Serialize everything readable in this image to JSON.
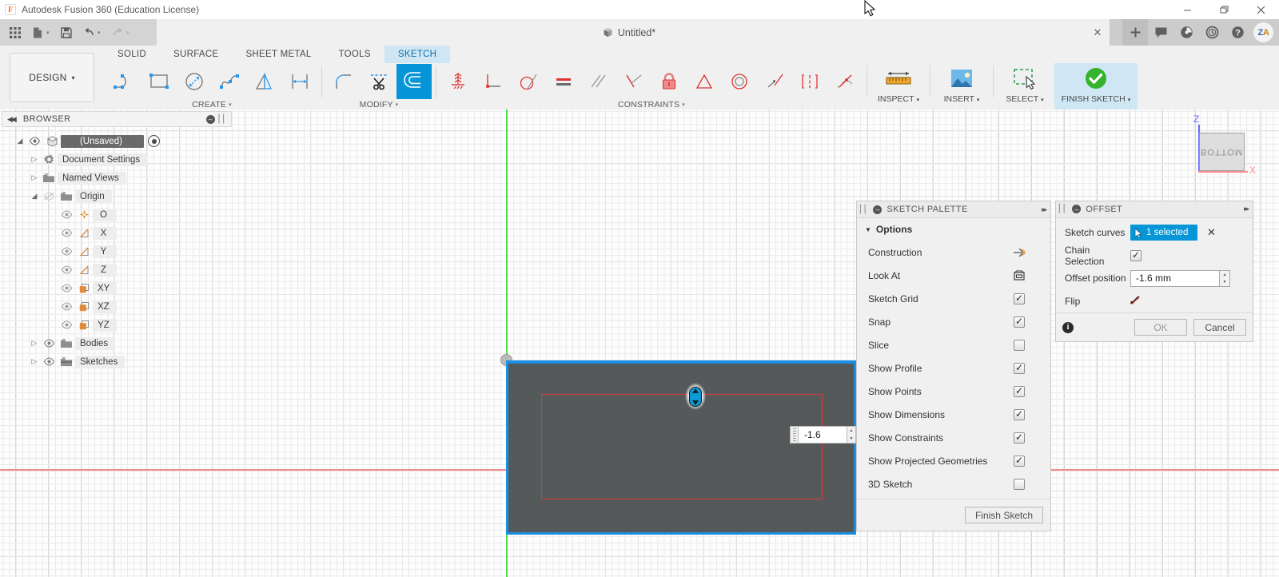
{
  "titlebar": {
    "app_title": "Autodesk Fusion 360 (Education License)",
    "logo_letter": "F",
    "minimize": "—",
    "maximize": "❐",
    "close": "✕"
  },
  "quick_access": {
    "grid_icon": "app-grid-icon",
    "new_icon": "new-document-icon",
    "save_icon": "save-icon",
    "undo_icon": "undo-icon",
    "redo_icon": "redo-icon",
    "document_title": "Untitled*",
    "tab_close": "✕",
    "add_tab": "+",
    "comments_icon": "comments-icon",
    "data_panel_icon": "data-panel-icon",
    "recent_icon": "recent-icon",
    "help_icon": "help-icon",
    "avatar_initials_z": "Z",
    "avatar_initials_a": "A"
  },
  "ribbon": {
    "workspace": "DESIGN",
    "workspace_caret": "▾",
    "tabs": [
      {
        "label": "SOLID",
        "active": false
      },
      {
        "label": "SURFACE",
        "active": false
      },
      {
        "label": "SHEET METAL",
        "active": false
      },
      {
        "label": "TOOLS",
        "active": false
      },
      {
        "label": "SKETCH",
        "active": true
      }
    ],
    "panels": [
      {
        "title": "CREATE",
        "has_dropdown": true
      },
      {
        "title": "MODIFY",
        "has_dropdown": true
      },
      {
        "title": "CONSTRAINTS",
        "has_dropdown": true
      },
      {
        "title": "INSPECT",
        "has_dropdown": true
      },
      {
        "title": "INSERT",
        "has_dropdown": true
      },
      {
        "title": "SELECT",
        "has_dropdown": true
      },
      {
        "title": "FINISH SKETCH",
        "has_dropdown": true
      }
    ],
    "create_tools": [
      "line-icon",
      "rectangle-icon",
      "circle-icon",
      "spline-icon",
      "mirror-icon",
      "dimension-icon"
    ],
    "modify_tools": [
      "fillet-icon",
      "trim-icon",
      "offset-icon"
    ],
    "constraint_tools": [
      "coincident-icon",
      "horizontal-vertical-icon",
      "tangent-icon",
      "equal-icon",
      "parallel-icon",
      "perpendicular-icon",
      "fix-lock-icon",
      "midpoint-icon",
      "concentric-icon",
      "collinear-icon",
      "symmetry-icon",
      "curvature-icon"
    ],
    "inspect_icon": "measure-ruler-icon",
    "insert_icon": "insert-image-icon",
    "select_icon": "select-window-icon",
    "finish_sketch_icon": "green-check-icon",
    "dropdown_caret": "▾"
  },
  "browser": {
    "header_title": "BROWSER",
    "collapse_arrows": "◀◀",
    "minimize": "—",
    "grip": "⁞⁞",
    "items": [
      {
        "label": "(Unsaved)",
        "indent": 0,
        "twist": "◢",
        "icon": "component-cube-icon",
        "eye": true,
        "root": true,
        "radio": true
      },
      {
        "label": "Document Settings",
        "indent": 1,
        "twist": "▷",
        "icon": "gear-icon",
        "eye": false,
        "root": false,
        "radio": false
      },
      {
        "label": "Named Views",
        "indent": 1,
        "twist": "▷",
        "icon": "folder-icon",
        "eye": false,
        "root": false,
        "radio": false
      },
      {
        "label": "Origin",
        "indent": 1,
        "twist": "◢",
        "icon": "folder-icon",
        "eye": true,
        "eye_off": true,
        "root": false,
        "radio": false
      },
      {
        "label": "O",
        "indent": 2,
        "twist": "",
        "icon": "origin-point-icon",
        "eye": true,
        "root": false,
        "radio": false
      },
      {
        "label": "X",
        "indent": 2,
        "twist": "",
        "icon": "axis-icon",
        "eye": true,
        "root": false,
        "radio": false
      },
      {
        "label": "Y",
        "indent": 2,
        "twist": "",
        "icon": "axis-icon",
        "eye": true,
        "root": false,
        "radio": false
      },
      {
        "label": "Z",
        "indent": 2,
        "twist": "",
        "icon": "axis-icon",
        "eye": true,
        "root": false,
        "radio": false
      },
      {
        "label": "XY",
        "indent": 2,
        "twist": "",
        "icon": "plane-icon",
        "eye": true,
        "root": false,
        "radio": false
      },
      {
        "label": "XZ",
        "indent": 2,
        "twist": "",
        "icon": "plane-icon",
        "eye": true,
        "root": false,
        "radio": false
      },
      {
        "label": "YZ",
        "indent": 2,
        "twist": "",
        "icon": "plane-icon",
        "eye": true,
        "root": false,
        "radio": false
      },
      {
        "label": "Bodies",
        "indent": 1,
        "twist": "▷",
        "icon": "folder-icon",
        "eye": true,
        "root": false,
        "radio": false
      },
      {
        "label": "Sketches",
        "indent": 1,
        "twist": "▷",
        "icon": "sketches-folder-icon",
        "eye": true,
        "root": false,
        "radio": false
      }
    ]
  },
  "sketch_palette": {
    "title": "SKETCH PALETTE",
    "minimize": "—",
    "expand": "▸▸",
    "grip": "⁞⁞",
    "section_title": "Options",
    "section_triangle": "▼",
    "options": [
      {
        "label": "Construction",
        "control": "icon",
        "icon": "construction-line-icon"
      },
      {
        "label": "Look At",
        "control": "icon",
        "icon": "look-at-icon"
      },
      {
        "label": "Sketch Grid",
        "control": "checkbox",
        "checked": true
      },
      {
        "label": "Snap",
        "control": "checkbox",
        "checked": true
      },
      {
        "label": "Slice",
        "control": "checkbox",
        "checked": false
      },
      {
        "label": "Show Profile",
        "control": "checkbox",
        "checked": true
      },
      {
        "label": "Show Points",
        "control": "checkbox",
        "checked": true
      },
      {
        "label": "Show Dimensions",
        "control": "checkbox",
        "checked": true
      },
      {
        "label": "Show Constraints",
        "control": "checkbox",
        "checked": true
      },
      {
        "label": "Show Projected Geometries",
        "control": "checkbox",
        "checked": true
      },
      {
        "label": "3D Sketch",
        "control": "checkbox",
        "checked": false
      }
    ],
    "finish_button": "Finish Sketch"
  },
  "offset_dialog": {
    "title": "OFFSET",
    "minimize": "—",
    "expand": "▸▸",
    "grip": "⁞⁞",
    "sketch_curves_label": "Sketch curves",
    "sketch_curves_value": "1 selected",
    "clear_selection": "✕",
    "chain_selection_label": "Chain Selection",
    "chain_selection_checked": true,
    "offset_position_label": "Offset position",
    "offset_position_value": "-1.6 mm",
    "flip_label": "Flip",
    "flip_icon": "flip-direction-icon",
    "info_icon": "i",
    "ok_label": "OK",
    "cancel_label": "Cancel",
    "spin_up": "▲",
    "spin_down": "▼"
  },
  "canvas": {
    "inline_value": "-1.6",
    "inline_spin_up": "▲",
    "inline_spin_down": "▼",
    "viewcube_face": "BOTTOM",
    "axis_z_label": "Z",
    "axis_x_label": "X",
    "origin_point": "origin-point",
    "drag_handle": "offset-drag-handle"
  },
  "colors": {
    "accent_blue": "#0696d7",
    "tab_active_bg": "#cfe7f5",
    "profile_fill": "#55595a",
    "profile_edge": "#1a8fe3",
    "offset_curve": "#d93a3a",
    "x_axis": "#f08b8b",
    "y_axis": "#4ddf4d",
    "ribbon_bg": "#f0f0f0",
    "panel_bg": "#f0f0f0"
  }
}
